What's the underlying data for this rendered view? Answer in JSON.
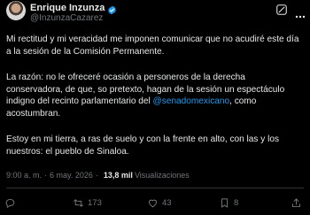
{
  "author": {
    "display_name": "Enrique Inzunza",
    "handle": "@InzunzaCazarez",
    "verified": true
  },
  "tweet": {
    "paragraph1": "Mi rectitud y mi veracidad me imponen comunicar que no acudiré este día a la sesión de la Comisión Permanente.",
    "paragraph2_before": "La razón: no le ofreceré ocasión a personeros de la derecha conservadora, de que, so pretexto, hagan de la sesión un espectáculo indigno del recinto parlamentario del ",
    "paragraph2_mention": "@senadomexicano",
    "paragraph2_after": ", como acostumbran.",
    "paragraph3": "Estoy en mi tierra, a ras de suelo y con la frente en alto, con las y los nuestros: el pueblo de Sinaloa."
  },
  "meta": {
    "time": "9:00 a. m.",
    "separator": "·",
    "date": "6 may. 2026",
    "views_count": "13,8 mil",
    "views_label": "Visualizaciones"
  },
  "actions": {
    "reply_count": "",
    "retweet_count": "173",
    "like_count": "43",
    "bookmark_count": "8",
    "share_count": ""
  },
  "colors": {
    "background": "#000000",
    "text": "#e7e9ea",
    "secondary": "#71767b",
    "accent": "#1d9bf0",
    "divider": "#2f3336"
  },
  "icons": [
    "verified-badge-icon",
    "grok-icon",
    "more-icon",
    "reply-icon",
    "retweet-icon",
    "like-icon",
    "bookmark-icon",
    "share-icon"
  ]
}
